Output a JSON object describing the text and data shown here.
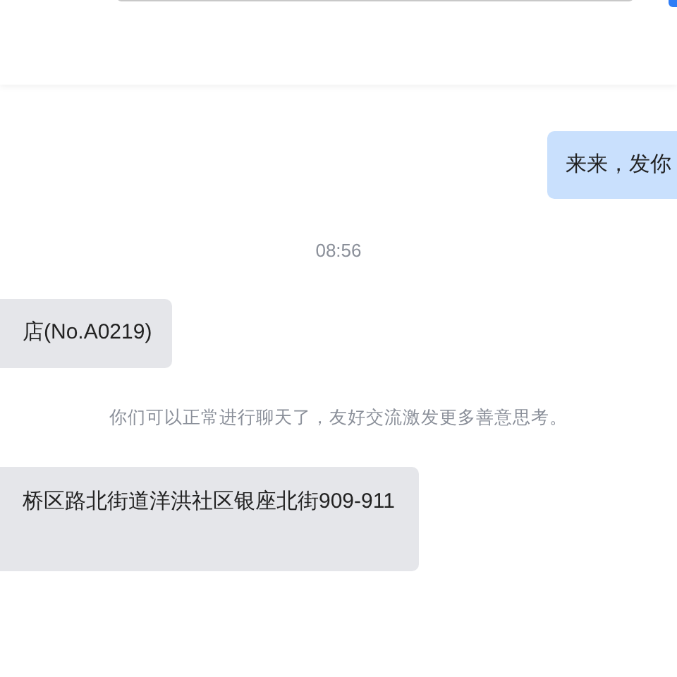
{
  "messages": [
    {
      "kind": "outgoing",
      "text": "来来，发你"
    },
    {
      "kind": "time",
      "text": "08:56"
    },
    {
      "kind": "incoming",
      "text": "店(No.A0219)"
    },
    {
      "kind": "notice",
      "text": "你们可以正常进行聊天了，友好交流激发更多善意思考。"
    },
    {
      "kind": "incoming",
      "text": "桥区路北街道洋洪社区银座北街909-911",
      "tall": true
    }
  ]
}
